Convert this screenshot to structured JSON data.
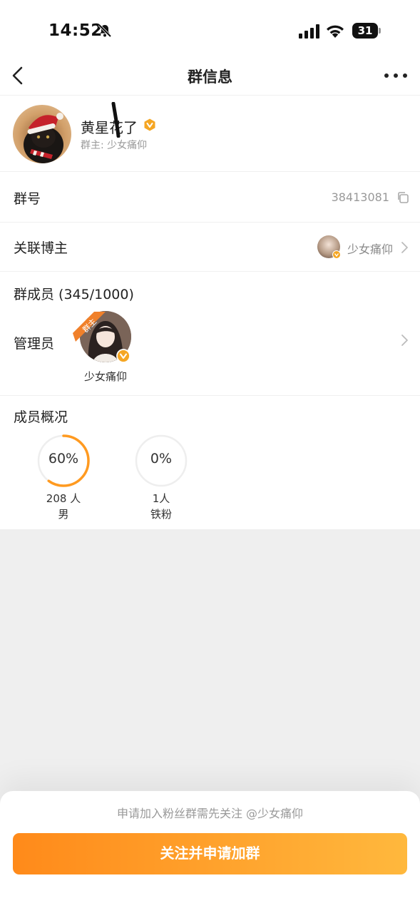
{
  "status_bar": {
    "time": "14:52",
    "battery": "31"
  },
  "nav": {
    "title": "群信息"
  },
  "group": {
    "name": "黄星花了",
    "owner_label": "群主:",
    "owner_name": "少女痛仰"
  },
  "rows": {
    "group_id_label": "群号",
    "group_id": "38413081",
    "blogger_label": "关联博主",
    "blogger_name": "少女痛仰"
  },
  "members": {
    "title": "群成员 (345/1000)",
    "admin_label": "管理员",
    "admin_badge": "群主",
    "admin_name": "少女痛仰"
  },
  "overview": {
    "title": "成员概况",
    "stats": [
      {
        "percent_text": "60%",
        "percent": 60,
        "count": "208 人",
        "label": "男"
      },
      {
        "percent_text": "0%",
        "percent": 0,
        "count": "1人",
        "label": "铁粉"
      }
    ]
  },
  "footer": {
    "notice": "申请加入粉丝群需先关注 @少女痛仰",
    "button": "关注并申请加群"
  },
  "colors": {
    "accent": "#ff9a20",
    "ring_track": "#eeeeee"
  },
  "icons": [
    "bell-muted-icon",
    "signal-icon",
    "wifi-icon",
    "battery-icon",
    "back-icon",
    "more-icon",
    "vip-badge-icon",
    "copy-icon",
    "chevron-right-icon"
  ]
}
